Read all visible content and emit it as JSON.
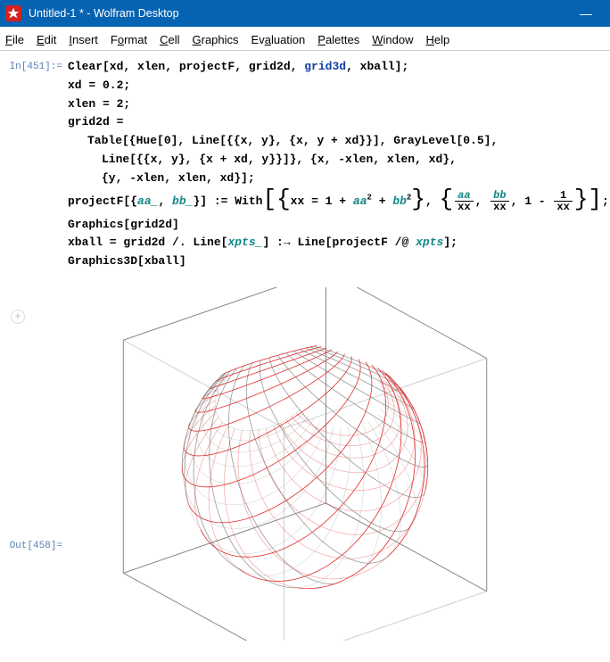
{
  "title": "Untitled-1 * - Wolfram Desktop",
  "menu": {
    "file": {
      "u": "F",
      "rest": "ile"
    },
    "edit": {
      "u": "E",
      "rest": "dit"
    },
    "insert": {
      "u": "I",
      "rest": "nsert"
    },
    "format": {
      "pre": "F",
      "u": "o",
      "rest": "rmat"
    },
    "cell": {
      "u": "C",
      "rest": "ell"
    },
    "graphics": {
      "u": "G",
      "rest": "raphics"
    },
    "evaluation": {
      "pre": "Ev",
      "u": "a",
      "rest": "luation"
    },
    "palettes": {
      "u": "P",
      "rest": "alettes"
    },
    "window": {
      "u": "W",
      "rest": "indow"
    },
    "help": {
      "u": "H",
      "rest": "elp"
    }
  },
  "labels": {
    "in": "In[451]:=",
    "out": "Out[458]="
  },
  "code": {
    "l1a": "Clear[xd, xlen, projectF, grid2d, ",
    "l1b": "grid3d",
    "l1c": ", xball];",
    "l2": "xd = 0.2;",
    "l3": "xlen = 2;",
    "l4": "grid2d =",
    "l5": "Table[{Hue[0], Line[{{x, y}, {x, y + xd}}], GrayLevel[0.5],",
    "l6": "Line[{{x, y}, {x + xd, y}}]}, {x, -xlen, xlen, xd},",
    "l7": "{y, -xlen, xlen, xd}];",
    "l8a": "projectF[{",
    "l8aa": "aa_",
    "l8b": ", ",
    "l8bb": "bb_",
    "l8c": "}] := With",
    "l8d": "xx = 1 + ",
    "l8e": "aa",
    "l8f": " + ",
    "l8g": "bb",
    "l8h": ", ",
    "frac1_num": "aa",
    "frac1_den": "xx",
    "frac2_num": "bb",
    "frac2_den": "xx",
    "frac3_num": "1",
    "frac3_den": "xx",
    "l9": "Graphics[grid2d]",
    "l10a": "xball = grid2d /. Line[",
    "l10b": "xpts_",
    "l10c": "] :→ Line[projectF /@ ",
    "l10d": "xpts",
    "l10e": "];",
    "l11": "Graphics3D[xball]",
    "comma": ", ",
    "one_minus": "1 - ",
    "two": "2",
    "semicolon": ";"
  }
}
